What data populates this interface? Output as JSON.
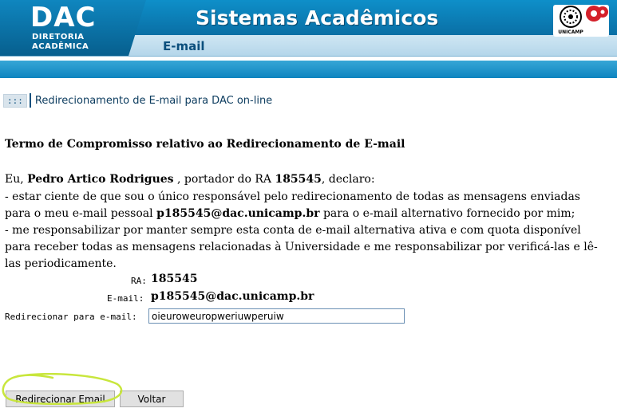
{
  "header": {
    "logo_text": "DAC",
    "logo_sub_line1": "DIRETORIA",
    "logo_sub_line2": "ACADÊMICA",
    "system_title": "Sistemas Acadêmicos",
    "section_title": "E-mail",
    "university": "UNICAMP"
  },
  "breadcrumb": {
    "marker": ":::",
    "text": "Redirecionamento de E-mail para DAC on-line"
  },
  "term": {
    "title": "Termo de Compromisso relativo ao Redirecionamento de E-mail",
    "intro_prefix": "Eu, ",
    "student_name": "Pedro Artico Rodrigues",
    "intro_middle": " , portador do RA ",
    "ra": "185545",
    "intro_suffix": ", declaro:",
    "clause1_prefix": "- estar ciente de que sou o único responsável pelo redirecionamento de todas as mensagens enviadas para o meu e-mail pessoal ",
    "email": "p185545@dac.unicamp.br",
    "clause1_suffix": " para o e-mail alternativo fornecido por mim;",
    "clause2": "- me responsabilizar por manter sempre esta conta de e-mail alternativa ativa e com quota disponível para receber todas as mensagens relacionadas à Universidade e me responsabilizar por verificá-las e lê-las periodicamente."
  },
  "form": {
    "ra_label": "RA:",
    "ra_value": "185545",
    "email_label": "E-mail:",
    "email_value": "p185545@dac.unicamp.br",
    "redirect_label": "Redirecionar para e-mail:",
    "redirect_value": "oieuroweuropweriuwperuiw"
  },
  "buttons": {
    "submit_label": "Redirecionar Email",
    "back_label": "Voltar"
  },
  "colors": {
    "header_blue": "#0e8fc9",
    "header_text": "#0b4f7d",
    "highlight": "#c8e63c"
  }
}
